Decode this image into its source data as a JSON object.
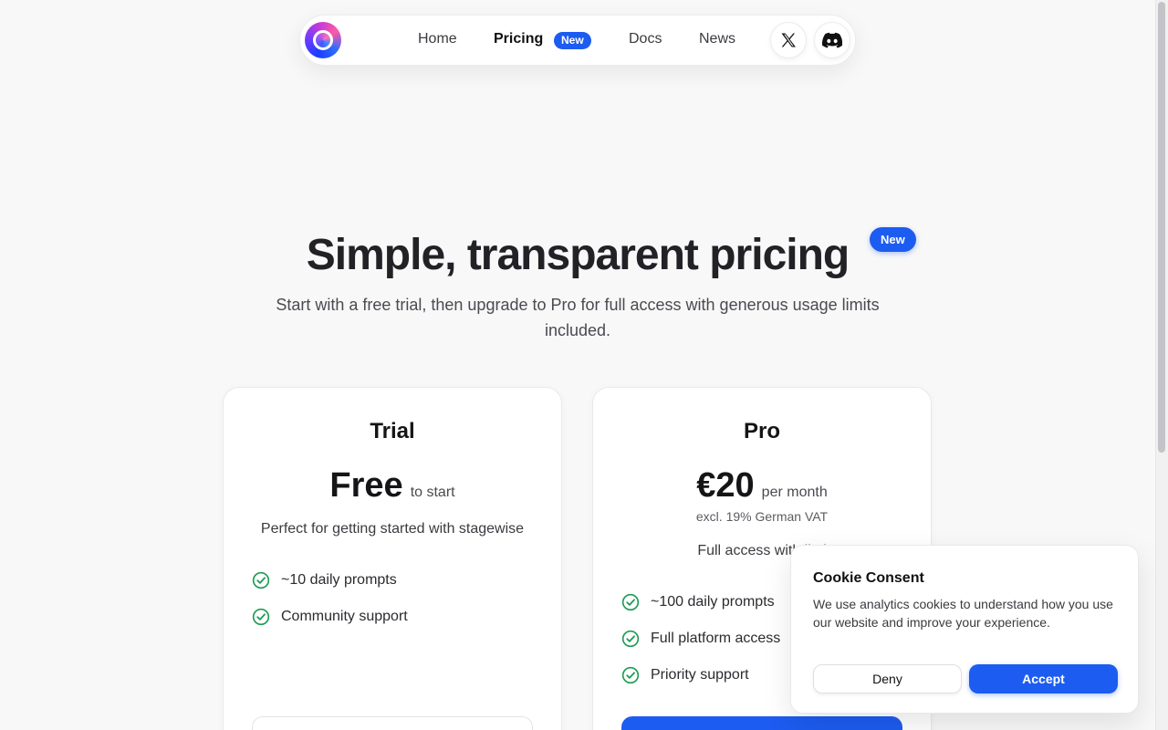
{
  "nav": {
    "links": [
      {
        "label": "Home"
      },
      {
        "label": "Pricing"
      },
      {
        "label": "Docs"
      },
      {
        "label": "News"
      }
    ],
    "pricing_badge": "New",
    "social": [
      "x-icon",
      "discord-icon"
    ]
  },
  "hero": {
    "title": "Simple, transparent pricing",
    "badge": "New",
    "subtitle": "Start with a free trial, then upgrade to Pro for full access with generous usage limits included."
  },
  "plans": {
    "trial": {
      "name": "Trial",
      "price": "Free",
      "price_suffix": "to start",
      "description": "Perfect for getting started with stagewise",
      "features": [
        "~10 daily prompts",
        "Community support"
      ]
    },
    "pro": {
      "name": "Pro",
      "price": "€20",
      "price_suffix": "per month",
      "vat_note": "excl. 19% German VAT",
      "description": "Full access with limi",
      "features": [
        "~100 daily prompts",
        "Full platform access",
        "Priority support"
      ]
    }
  },
  "cookie": {
    "title": "Cookie Consent",
    "text": "We use analytics cookies to understand how you use our website and improve your experience.",
    "deny_label": "Deny",
    "accept_label": "Accept"
  },
  "colors": {
    "accent": "#1d5cf0",
    "check_green": "#1f9d55",
    "background": "#f8f8f9"
  }
}
